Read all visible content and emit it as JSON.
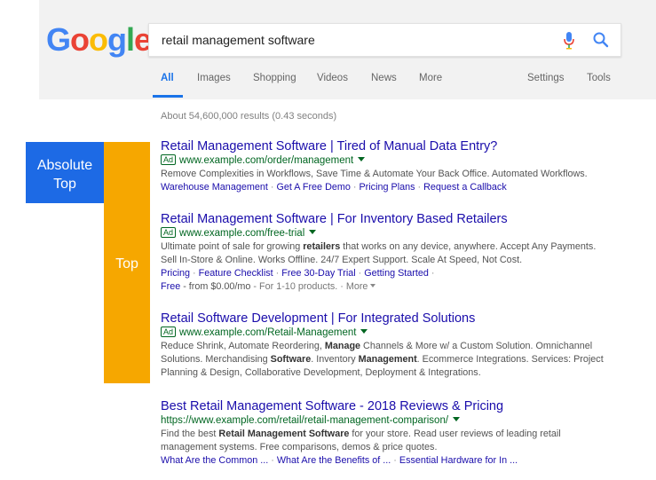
{
  "search": {
    "logo": "Google",
    "query": "retail management software",
    "mic_icon": "microphone-icon",
    "search_icon": "search-icon"
  },
  "tabs": {
    "all": "All",
    "images": "Images",
    "shopping": "Shopping",
    "videos": "Videos",
    "news": "News",
    "more": "More",
    "settings": "Settings",
    "tools": "Tools"
  },
  "stats": "About 54,600,000 results (0.43 seconds)",
  "labels": {
    "absolute_top_line1": "Absolute",
    "absolute_top_line2": "Top",
    "top": "Top",
    "absolute_color": "#1d6ae5",
    "top_color": "#f6a700"
  },
  "ad_badge": "Ad",
  "results": {
    "r1": {
      "title": "Retail Management Software | Tired of Manual Data Entry?",
      "url": "www.example.com/order/management",
      "desc": "Remove Complexities in Workflows, Save Time & Automate Your Back Office. Automated Workflows.",
      "links": [
        "Warehouse Management",
        "Get A Free Demo",
        "Pricing Plans",
        "Request a Callback"
      ]
    },
    "r2": {
      "title": "Retail Management Software | For Inventory Based Retailers",
      "url": "www.example.com/free-trial",
      "desc1_a": "Ultimate point of sale for growing ",
      "desc1_b": "retailers",
      "desc1_c": " that works on any device, anywhere. Accept Any Payments.",
      "desc2": "Sell In-Store & Online. Works Offline. 24/7 Expert Support. Scale At Speed, Not Cost.",
      "links": [
        "Pricing",
        "Feature Checklist",
        "Free 30-Day Trial",
        "Getting Started"
      ],
      "price_link": "Free",
      "price_text": " - from $0.00/mo",
      "price_note": " - For 1-10 products. · ",
      "more": "More"
    },
    "r3": {
      "title": "Retail Software Development | For Integrated Solutions",
      "url": "www.example.com/Retail-Management",
      "d1": "Reduce Shrink, Automate Reordering, ",
      "d1b": "Manage",
      "d1c": " Channels & More w/ a Custom Solution. Omnichannel",
      "d2": "Solutions. Merchandising ",
      "d2b": "Software",
      "d2c": ". Inventory ",
      "d2d": "Management",
      "d2e": ". Ecommerce Integrations. Services: Project",
      "d3": "Planning & Design, Collaborative Development, Deployment & Integrations."
    },
    "r4": {
      "title": "Best Retail Management Software - 2018 Reviews & Pricing",
      "url": "https://www.example.com/retail/retail-management-comparison/",
      "d1": "Find the best ",
      "d1b": "Retail Management Software",
      "d1c": " for your store. Read user reviews of leading retail",
      "d2": "management systems. Free comparisons, demos & price quotes.",
      "links": [
        "What Are the Common ...",
        "What Are the Benefits of ...",
        "Essential Hardware for In ..."
      ]
    }
  }
}
